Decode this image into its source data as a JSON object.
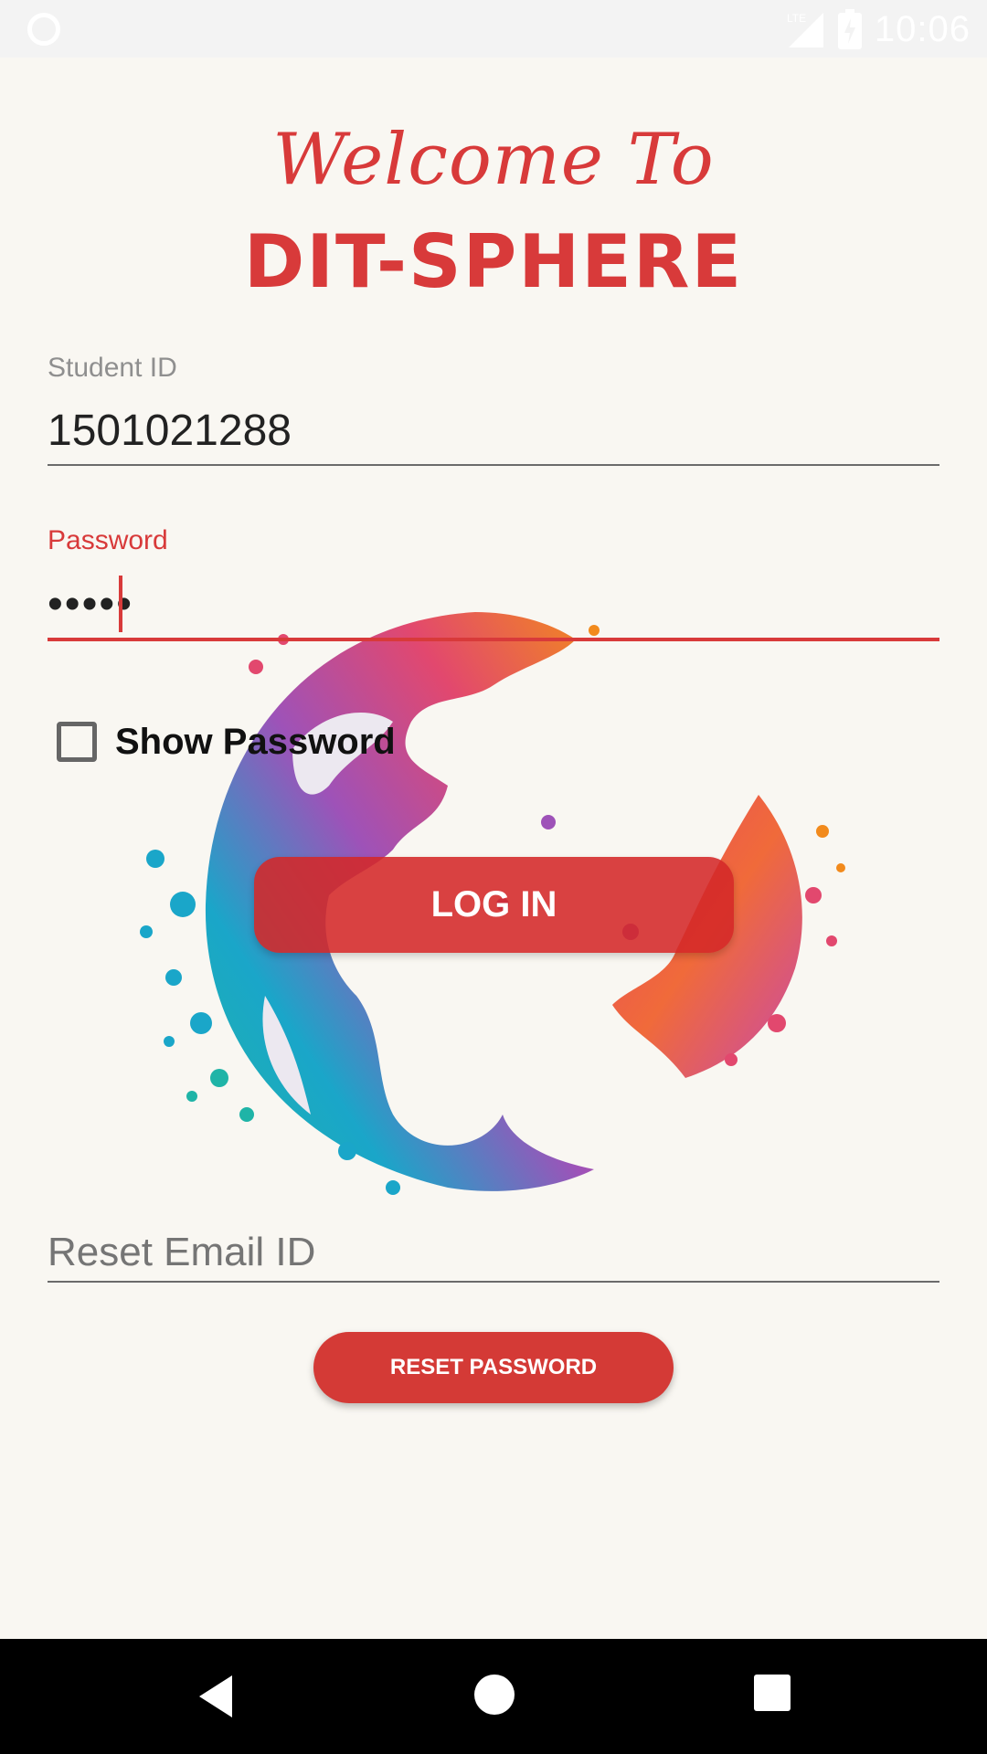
{
  "status_bar": {
    "time": "10:06",
    "network": "LTE"
  },
  "header": {
    "welcome": "Welcome To",
    "brand": "DIT-SPHERE"
  },
  "form": {
    "student_id": {
      "label": "Student ID",
      "value": "1501021288"
    },
    "password": {
      "label": "Password",
      "value": "•••••"
    },
    "show_password": {
      "label": "Show Password",
      "checked": false
    },
    "login_button": "LOG IN",
    "reset_email": {
      "placeholder": "Reset Email ID",
      "value": ""
    },
    "reset_button": "RESET PASSWORD"
  },
  "colors": {
    "accent": "#d83a3a",
    "background": "#f9f7f2"
  },
  "icons": {
    "status_left": "notification-ring-icon",
    "globe": "paint-splash-globe",
    "nav_back": "back-triangle-icon",
    "nav_home": "home-circle-icon",
    "nav_recent": "recent-square-icon"
  }
}
